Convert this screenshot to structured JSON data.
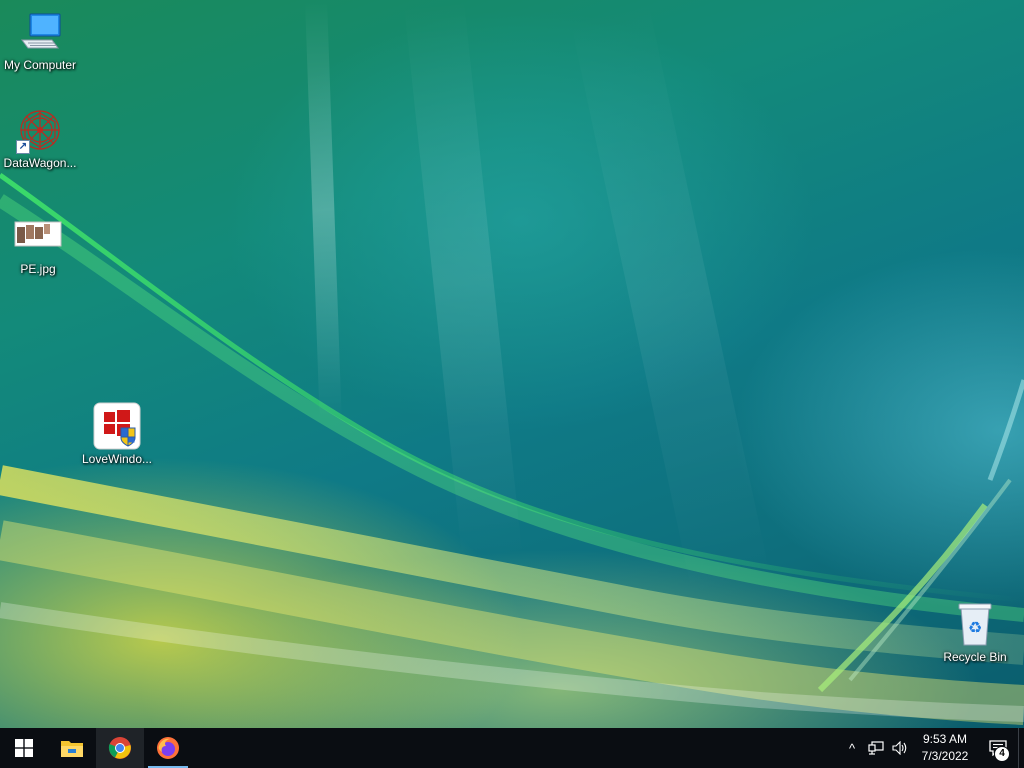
{
  "desktop": {
    "icons": [
      {
        "label": "My Computer",
        "icon": "computer-icon"
      },
      {
        "label": "DataWagon...",
        "icon": "datawagon-icon"
      },
      {
        "label": "PE.jpg",
        "icon": "image-file-icon"
      },
      {
        "label": "LoveWindo...",
        "icon": "lovewindows-icon"
      },
      {
        "label": "Recycle Bin",
        "icon": "recycle-bin-icon"
      }
    ]
  },
  "taskbar": {
    "apps": [
      {
        "name": "Start",
        "icon": "windows-start-icon"
      },
      {
        "name": "File Explorer",
        "icon": "file-explorer-icon"
      },
      {
        "name": "Google Chrome",
        "icon": "chrome-icon"
      },
      {
        "name": "Firefox",
        "icon": "firefox-icon"
      }
    ],
    "tray": {
      "overflow_glyph": "^",
      "time": "9:53 AM",
      "date": "7/3/2022",
      "notification_count": "4"
    }
  },
  "colors": {
    "taskbar_bg": "#0a0d12",
    "running_indicator": "#76b9ed",
    "label_text": "#ffffff"
  }
}
